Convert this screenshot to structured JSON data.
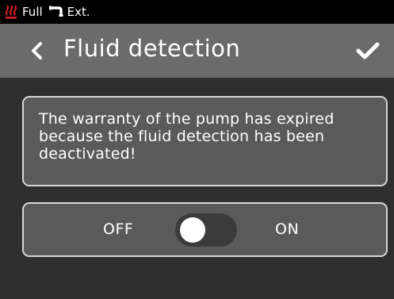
{
  "status_bar": {
    "power_label": "Full",
    "source_label": "Ext."
  },
  "header": {
    "title": "Fluid detection",
    "back_icon": "chevron-left-icon",
    "confirm_icon": "checkmark-icon"
  },
  "warning": {
    "text": "The warranty of the pump has expired because the fluid detection has been deactivated!"
  },
  "toggle": {
    "off_label": "OFF",
    "on_label": "ON",
    "state": "off"
  },
  "colors": {
    "status_bar_bg": "#000000",
    "header_bg": "#6b6b6b",
    "screen_bg": "#2f2f2f",
    "panel_bg": "#5a5a5a",
    "panel_border": "#d6d6d6",
    "heater_icon": "#e02020"
  }
}
